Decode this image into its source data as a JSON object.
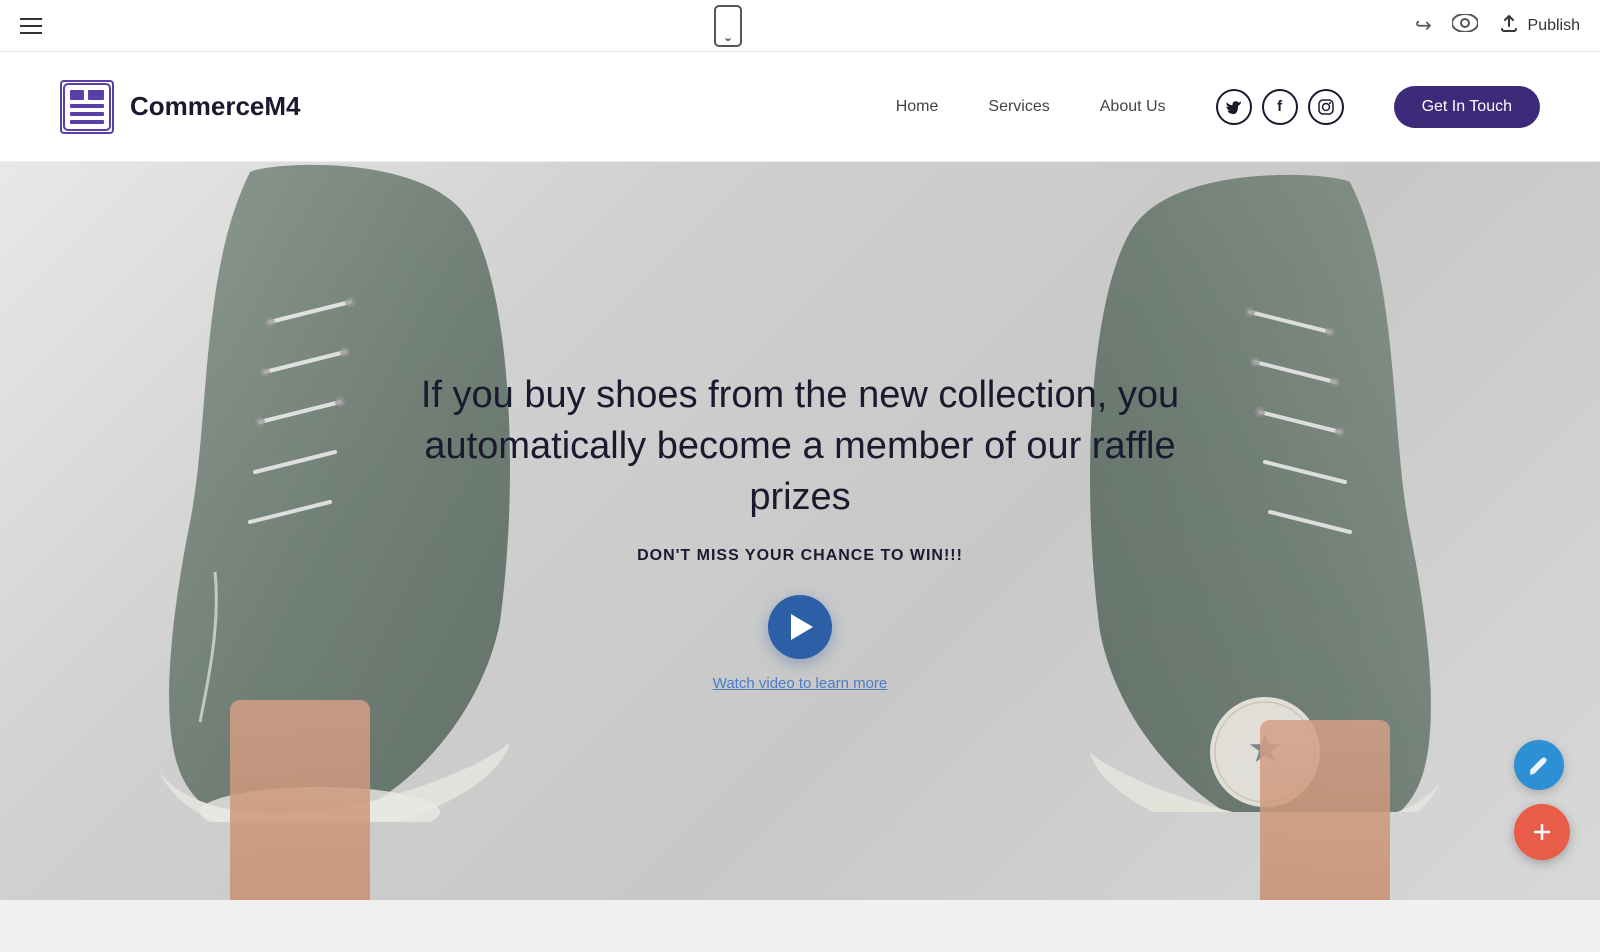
{
  "toolbar": {
    "publish_label": "Publish"
  },
  "site": {
    "logo_name": "CommerceM4",
    "nav": {
      "home": "Home",
      "services": "Services",
      "about_us": "About Us"
    },
    "cta_button": "Get In Touch",
    "hero": {
      "title": "If you buy shoes from the new collection, you automatically become a member of our raffle prizes",
      "subtitle": "DON'T MISS YOUR CHANCE TO WIN!!!",
      "watch_video": "Watch video to learn more"
    }
  }
}
